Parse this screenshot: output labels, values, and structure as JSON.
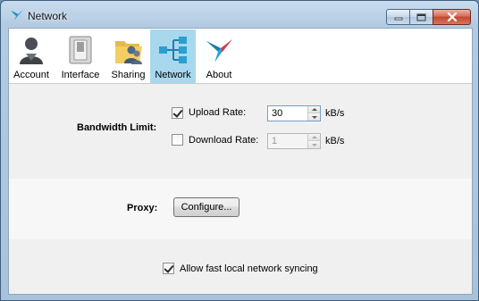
{
  "window": {
    "title": "Network",
    "icon": "app-bird-icon",
    "buttons": [
      "minimize-icon",
      "maximize-icon",
      "close-icon"
    ]
  },
  "tabs": [
    {
      "label": "Account",
      "icon": "account-person-icon",
      "active": false
    },
    {
      "label": "Interface",
      "icon": "interface-switch-icon",
      "active": false
    },
    {
      "label": "Sharing",
      "icon": "sharing-folder-icon",
      "active": false
    },
    {
      "label": "Network",
      "icon": "network-tree-icon",
      "active": true
    },
    {
      "label": "About",
      "icon": "about-bird-icon",
      "active": false
    }
  ],
  "bandwidth": {
    "section_label": "Bandwidth Limit:",
    "upload": {
      "label": "Upload Rate:",
      "checked": true,
      "value": "30",
      "unit": "kB/s",
      "enabled": true
    },
    "download": {
      "label": "Download Rate:",
      "checked": false,
      "value": "1",
      "unit": "kB/s",
      "enabled": false
    }
  },
  "proxy": {
    "section_label": "Proxy:",
    "button_label": "Configure..."
  },
  "lan": {
    "label": "Allow fast local network syncing",
    "checked": true
  },
  "colors": {
    "active_tab": "#a8d8ee",
    "accent": "#2a9fd0"
  }
}
